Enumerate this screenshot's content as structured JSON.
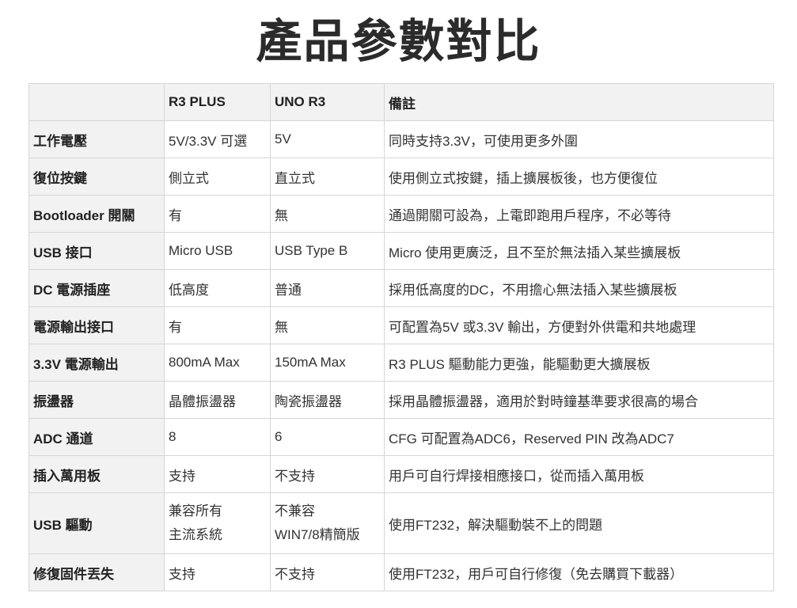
{
  "title": "產品參數對比",
  "table": {
    "headers": [
      "",
      "R3 PLUS",
      "UNO R3",
      "備註"
    ],
    "rows": [
      {
        "feature": "工作電壓",
        "r3plus": [
          "5V/3.3V 可選"
        ],
        "unor3": [
          "5V"
        ],
        "note": "同時支持3.3V，可使用更多外圍"
      },
      {
        "feature": "復位按鍵",
        "r3plus": [
          "側立式"
        ],
        "unor3": [
          "直立式"
        ],
        "note": "使用側立式按鍵，插上擴展板後，也方便復位"
      },
      {
        "feature": "Bootloader 開關",
        "r3plus": [
          "有"
        ],
        "unor3": [
          "無"
        ],
        "note": "通過開關可設為，上電即跑用戶程序，不必等待"
      },
      {
        "feature": "USB 接口",
        "r3plus": [
          "Micro USB"
        ],
        "unor3": [
          "USB Type B"
        ],
        "note": "Micro 使用更廣泛，且不至於無法插入某些擴展板"
      },
      {
        "feature": "DC 電源插座",
        "r3plus": [
          "低高度"
        ],
        "unor3": [
          "普通"
        ],
        "note": "採用低高度的DC，不用擔心無法插入某些擴展板"
      },
      {
        "feature": "電源輸出接口",
        "r3plus": [
          "有"
        ],
        "unor3": [
          "無"
        ],
        "note": "可配置為5V 或3.3V 輸出，方便對外供電和共地處理"
      },
      {
        "feature": "3.3V 電源輸出",
        "r3plus": [
          "800mA Max"
        ],
        "unor3": [
          "150mA Max"
        ],
        "note": "R3 PLUS 驅動能力更強，能驅動更大擴展板"
      },
      {
        "feature": "振盪器",
        "r3plus": [
          "晶體振盪器"
        ],
        "unor3": [
          "陶瓷振盪器"
        ],
        "note": "採用晶體振盪器，適用於對時鐘基準要求很高的場合"
      },
      {
        "feature": "ADC 通道",
        "r3plus": [
          "8"
        ],
        "unor3": [
          "6"
        ],
        "note": "CFG 可配置為ADC6，Reserved PIN 改為ADC7"
      },
      {
        "feature": "插入萬用板",
        "r3plus": [
          "支持"
        ],
        "unor3": [
          "不支持"
        ],
        "note": "用戶可自行焊接相應接口，從而插入萬用板"
      },
      {
        "feature": "USB 驅動",
        "r3plus": [
          "兼容所有",
          "主流系統"
        ],
        "unor3": [
          "不兼容",
          "WIN7/8精簡版"
        ],
        "note": "使用FT232，解決驅動裝不上的問題"
      },
      {
        "feature": "修復固件丟失",
        "r3plus": [
          "支持"
        ],
        "unor3": [
          "不支持"
        ],
        "note": "使用FT232，用戶可自行修復（免去購買下載器）"
      }
    ]
  }
}
